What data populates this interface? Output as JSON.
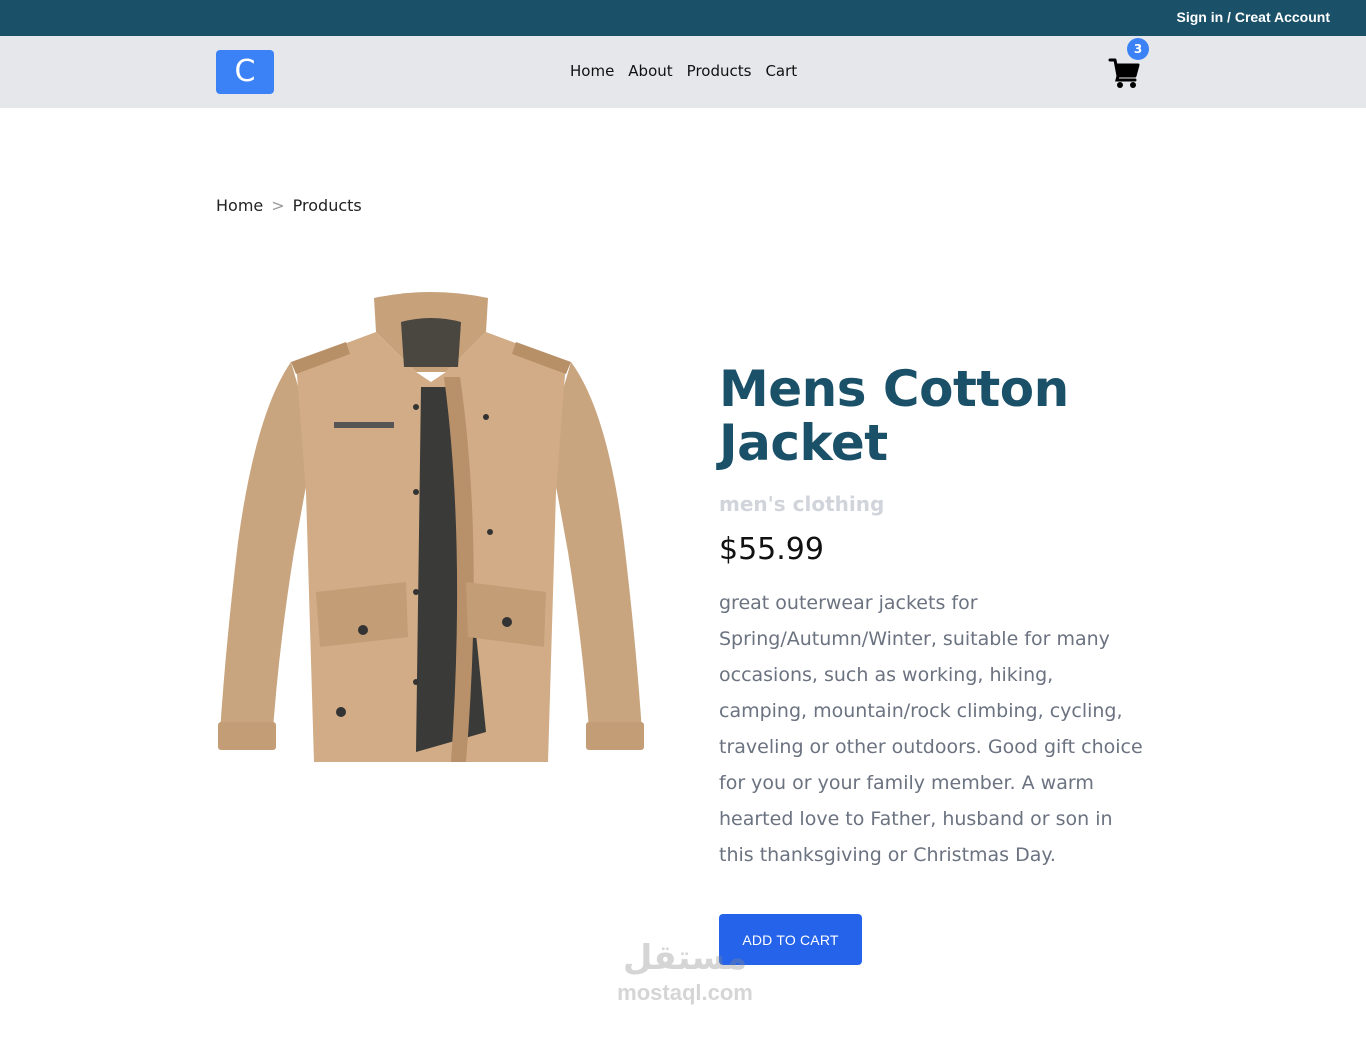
{
  "topbar": {
    "auth_label": "Sign in / Creat Account"
  },
  "navbar": {
    "logo_letter": "C",
    "links": [
      "Home",
      "About",
      "Products",
      "Cart"
    ],
    "cart_count": "3"
  },
  "breadcrumb": {
    "items": [
      "Home",
      "Products"
    ],
    "separator": ">"
  },
  "product": {
    "title_line1": "Mens Cotton",
    "title_line2": "Jacket",
    "category": "men's clothing",
    "price": "$55.99",
    "description": "great outerwear jackets for Spring/Autumn/Winter, suitable for many occasions, such as working, hiking, camping, mountain/rock climbing, cycling, traveling or other outdoors. Good gift choice for you or your family member. A warm hearted love to Father, husband or son in this thanksgiving or Christmas Day.",
    "add_to_cart_label": "ADD TO CART"
  },
  "watermark": {
    "arabic": "مستقل",
    "latin": "mostaql.com"
  },
  "colors": {
    "topbar": "#1a5068",
    "navbar": "#e5e7eb",
    "accent": "#3b82f6",
    "button": "#2563eb",
    "title": "#1a5068"
  }
}
